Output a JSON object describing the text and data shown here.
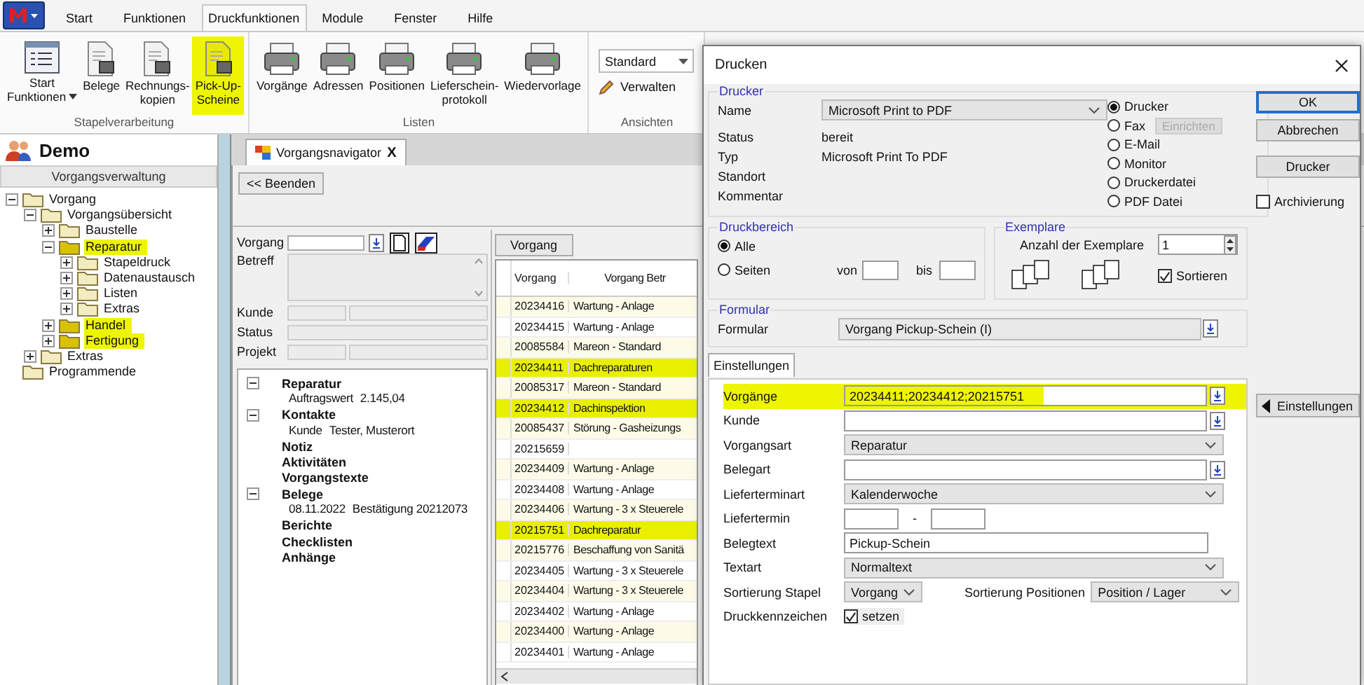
{
  "ribbon": {
    "tabs": [
      {
        "label": "Start",
        "selected": false
      },
      {
        "label": "Funktionen",
        "selected": false
      },
      {
        "label": "Druckfunktionen",
        "selected": true
      },
      {
        "label": "Module",
        "selected": false
      },
      {
        "label": "Fenster",
        "selected": false
      },
      {
        "label": "Hilfe",
        "selected": false
      }
    ],
    "groups": [
      {
        "label": "Stapelverarbeitung",
        "kind": "buttons",
        "buttons": [
          {
            "lines": [
              "Start",
              "Funktionen"
            ],
            "dropdown": true,
            "highlighted": false
          },
          {
            "lines": [
              "Belege"
            ],
            "dropdown": false,
            "highlighted": false
          },
          {
            "lines": [
              "Rechnungs-",
              "kopien"
            ],
            "dropdown": false,
            "highlighted": false
          },
          {
            "lines": [
              "Pick-Up-",
              "Scheine"
            ],
            "dropdown": false,
            "highlighted": true
          }
        ]
      },
      {
        "label": "Listen",
        "kind": "buttons",
        "buttons": [
          {
            "lines": [
              "Vorgänge"
            ],
            "dropdown": false,
            "highlighted": false
          },
          {
            "lines": [
              "Adressen"
            ],
            "dropdown": false,
            "highlighted": false
          },
          {
            "lines": [
              "Positionen"
            ],
            "dropdown": false,
            "highlighted": false
          },
          {
            "lines": [
              "Lieferschein-",
              "protokoll"
            ],
            "dropdown": false,
            "highlighted": false
          },
          {
            "lines": [
              "Wiedervorlage"
            ],
            "dropdown": false,
            "highlighted": false
          }
        ]
      },
      {
        "label": "Ansichten",
        "kind": "views",
        "view": "Standard",
        "manage": "Verwalten"
      }
    ]
  },
  "sidebar": {
    "title": "Demo",
    "section": "Vorgangsverwaltung",
    "tree": [
      {
        "label": "Vorgang",
        "expanded": true,
        "highlighted": false,
        "children": [
          {
            "label": "Vorgangsübersicht",
            "expanded": true,
            "highlighted": false,
            "children": [
              {
                "label": "Baustelle",
                "expanded": false,
                "highlighted": false
              },
              {
                "label": "Reparatur",
                "expanded": true,
                "highlighted": true,
                "children": [
                  {
                    "label": "Stapeldruck",
                    "expanded": false,
                    "highlighted": false
                  },
                  {
                    "label": "Datenaustausch",
                    "expanded": false,
                    "highlighted": false
                  },
                  {
                    "label": "Listen",
                    "expanded": false,
                    "highlighted": false
                  },
                  {
                    "label": "Extras",
                    "expanded": false,
                    "highlighted": false
                  }
                ]
              },
              {
                "label": "Handel",
                "expanded": false,
                "highlighted": true
              },
              {
                "label": "Fertigung",
                "expanded": false,
                "highlighted": true
              }
            ]
          },
          {
            "label": "Extras",
            "expanded": false,
            "highlighted": false
          }
        ]
      },
      {
        "label": "Programmende",
        "highlighted": false
      }
    ]
  },
  "navigator": {
    "tab": "Vorgangsnavigator",
    "close": "X",
    "back_button": "<< Beenden",
    "form": [
      {
        "label": "Vorgang",
        "kind": "picker"
      },
      {
        "label": "Betreff",
        "kind": "memo"
      },
      {
        "label": "Kunde",
        "kind": "pair"
      },
      {
        "label": "Status",
        "kind": "single"
      },
      {
        "label": "Projekt",
        "kind": "pair"
      }
    ],
    "sections": [
      {
        "label": "Reparatur",
        "expanded": true,
        "details": [
          {
            "label": "Auftragswert",
            "value": "2.145,04"
          }
        ]
      },
      {
        "label": "Kontakte",
        "expanded": true,
        "details": [
          {
            "label": "Kunde",
            "value": "Tester, Musterort"
          }
        ]
      },
      {
        "label": "Notiz"
      },
      {
        "label": "Aktivitäten"
      },
      {
        "label": "Vorgangstexte"
      },
      {
        "label": "Belege",
        "expanded": true,
        "details": [
          {
            "label": "08.11.2022",
            "value": "Bestätigung 20212073"
          }
        ]
      },
      {
        "label": "Berichte"
      },
      {
        "label": "Checklisten"
      },
      {
        "label": "Anhänge"
      }
    ],
    "table": {
      "tab": "Vorgang",
      "columns": [
        "Vorgang",
        "Vorgang Betr"
      ],
      "rows": [
        {
          "cells": [
            "20234416",
            "Wartung - Anlage"
          ],
          "highlighted": false
        },
        {
          "cells": [
            "20234415",
            "Wartung - Anlage"
          ],
          "highlighted": false
        },
        {
          "cells": [
            "20085584",
            "Mareon - Standard"
          ],
          "highlighted": false
        },
        {
          "cells": [
            "20234411",
            "Dachreparaturen"
          ],
          "highlighted": true
        },
        {
          "cells": [
            "20085317",
            "Mareon - Standard"
          ],
          "highlighted": false
        },
        {
          "cells": [
            "20234412",
            "Dachinspektion"
          ],
          "highlighted": true
        },
        {
          "cells": [
            "20085437",
            "Störung - Gasheizungs"
          ],
          "highlighted": false
        },
        {
          "cells": [
            "20215659",
            ""
          ],
          "highlighted": false
        },
        {
          "cells": [
            "20234409",
            "Wartung - Anlage"
          ],
          "highlighted": false
        },
        {
          "cells": [
            "20234408",
            "Wartung - Anlage"
          ],
          "highlighted": false
        },
        {
          "cells": [
            "20234406",
            "Wartung - 3 x Steuerele"
          ],
          "highlighted": false
        },
        {
          "cells": [
            "20215751",
            "Dachreparatur"
          ],
          "highlighted": true
        },
        {
          "cells": [
            "20215776",
            "Beschaffung von Sanitä"
          ],
          "highlighted": false
        },
        {
          "cells": [
            "20234405",
            "Wartung - 3 x Steuerele"
          ],
          "highlighted": false
        },
        {
          "cells": [
            "20234404",
            "Wartung - 3 x Steuerele"
          ],
          "highlighted": false
        },
        {
          "cells": [
            "20234402",
            "Wartung - Anlage"
          ],
          "highlighted": false
        },
        {
          "cells": [
            "20234400",
            "Wartung - Anlage"
          ],
          "highlighted": false
        },
        {
          "cells": [
            "20234401",
            "Wartung - Anlage"
          ],
          "highlighted": false
        }
      ]
    }
  },
  "dialog": {
    "title": "Drucken",
    "printer": {
      "legend": "Drucker",
      "name_label": "Name",
      "name": "Microsoft Print to PDF",
      "info": [
        {
          "label": "Status",
          "value": "bereit"
        },
        {
          "label": "Typ",
          "value": "Microsoft Print To PDF"
        },
        {
          "label": "Standort"
        },
        {
          "label": "Kommentar"
        }
      ],
      "outputs": [
        {
          "label": "Drucker",
          "selected": true
        },
        {
          "label": "Fax",
          "selected": false
        },
        {
          "label": "E-Mail",
          "selected": false
        },
        {
          "label": "Monitor",
          "selected": false
        },
        {
          "label": "Druckerdatei",
          "selected": false
        },
        {
          "label": "PDF Datei",
          "selected": false
        }
      ],
      "setup_button": {
        "label": "Einrichten",
        "disabled": true
      }
    },
    "buttons": [
      {
        "label": "OK",
        "default": true
      },
      {
        "label": "Abbrechen",
        "default": false
      },
      {
        "label": "Drucker",
        "default": false
      }
    ],
    "archive": {
      "label": "Archivierung",
      "checked": false
    },
    "range": {
      "legend": "Druckbereich",
      "options": [
        {
          "label": "Alle",
          "selected": true
        },
        {
          "label": "Seiten",
          "selected": false
        }
      ],
      "from": "von",
      "to": "bis"
    },
    "copies": {
      "legend": "Exemplare",
      "label": "Anzahl der Exemplare",
      "value": "1",
      "collate": {
        "label": "Sortieren",
        "checked": true
      }
    },
    "form": {
      "legend": "Formular",
      "label": "Formular",
      "value": "Vorgang Pickup-Schein (I)"
    },
    "settings_tab": "Einstellungen",
    "settings": [
      {
        "label": "Vorgänge",
        "kind": "picker",
        "value": "20234411;20234412;20215751",
        "highlighted": true
      },
      {
        "label": "Kunde",
        "kind": "picker",
        "highlighted": false
      },
      {
        "label": "Vorgangsart",
        "kind": "select",
        "value": "Reparatur",
        "highlighted": false
      },
      {
        "label": "Belegart",
        "kind": "picker",
        "highlighted": false
      },
      {
        "label": "Lieferterminart",
        "kind": "select",
        "value": "Kalenderwoche",
        "highlighted": false
      },
      {
        "label": "Liefertermin",
        "kind": "range",
        "separator": "-",
        "highlighted": false
      },
      {
        "label": "Belegtext",
        "kind": "text",
        "value": "Pickup-Schein",
        "highlighted": false
      },
      {
        "label": "Textart",
        "kind": "select",
        "value": "Normaltext",
        "highlighted": false
      },
      {
        "label": "Sortierung Stapel",
        "kind": "sortpair",
        "value": "Vorgang",
        "label2": "Sortierung Positionen",
        "value2": "Position / Lager",
        "highlighted": false
      },
      {
        "label": "Druckkennzeichen",
        "kind": "check",
        "check_label": "setzen",
        "checked": true,
        "highlighted": false
      }
    ],
    "settings_button": "Einstellungen"
  }
}
